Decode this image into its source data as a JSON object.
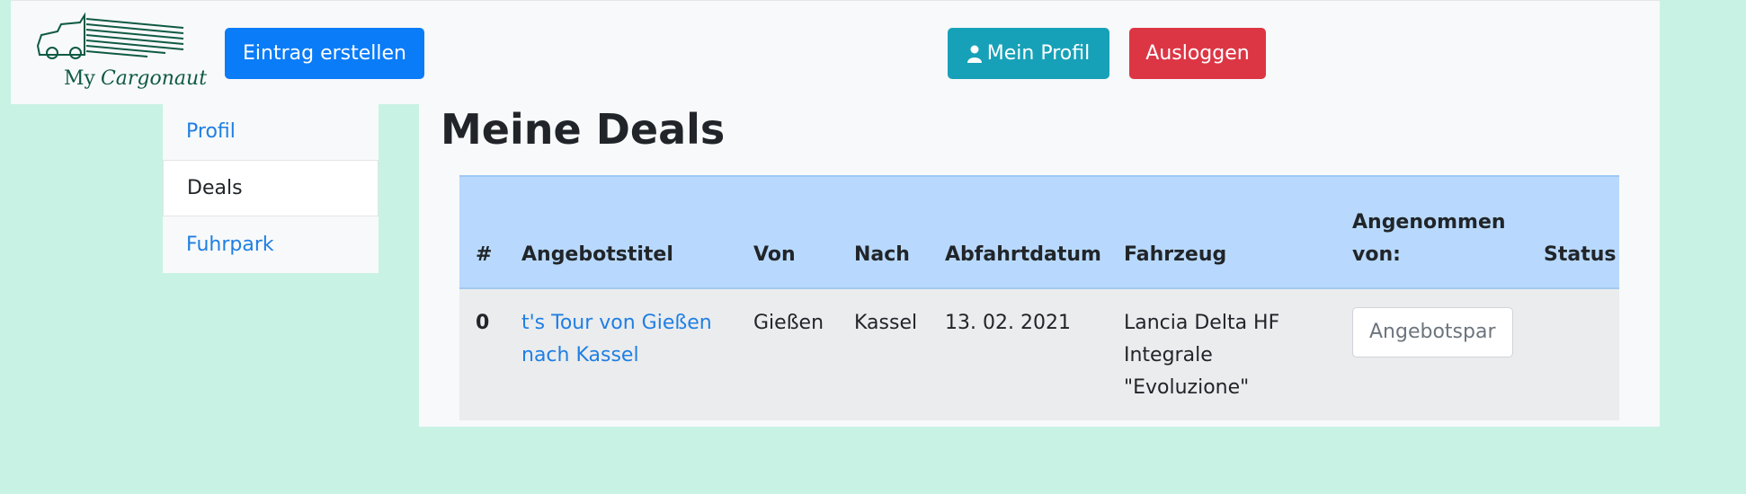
{
  "navbar": {
    "logo": {
      "word1": "My",
      "word2": "Cargonaut"
    },
    "create_label": "Eintrag erstellen",
    "profile_label": "Mein Profil",
    "logout_label": "Ausloggen"
  },
  "sidebar": {
    "items": [
      {
        "label": "Profil"
      },
      {
        "label": "Deals"
      },
      {
        "label": "Fuhrpark"
      }
    ]
  },
  "main": {
    "title": "Meine Deals",
    "table": {
      "headers": [
        "#",
        "Angebotstitel",
        "Von",
        "Nach",
        "Abfahrtdatum",
        "Fahrzeug",
        "Angenommen von:",
        "Status"
      ],
      "rows": [
        {
          "index": "0",
          "title": "t's Tour von Gießen nach Kassel",
          "from": "Gießen",
          "to": "Kassel",
          "date": "13. 02. 2021",
          "vehicle": "Lancia Delta HF Integrale \"Evoluzione\"",
          "accepted_by": "Angebotspar",
          "status": ""
        }
      ]
    }
  },
  "colors": {
    "page_bg": "#c8f2e4",
    "primary": "#0b7cf7",
    "info": "#17a1b8",
    "danger": "#dc3645",
    "table_head": "#b8d9fd",
    "logo": "#0f5a43"
  }
}
